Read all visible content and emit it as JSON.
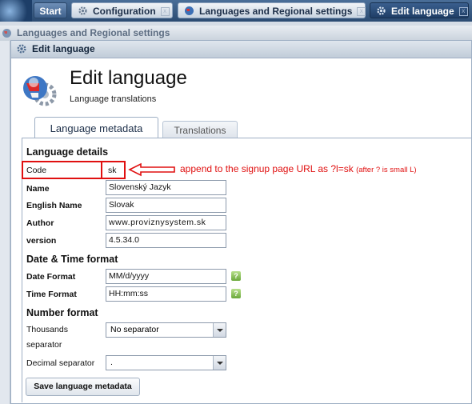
{
  "taskbar": {
    "start_label": "Start",
    "tabs": [
      {
        "label": "Configuration",
        "close": "x"
      },
      {
        "label": "Languages and Regional settings",
        "close": "x"
      },
      {
        "label": "Edit language",
        "close": "x"
      }
    ]
  },
  "window_back": {
    "title": "Languages and Regional settings"
  },
  "window": {
    "title": "Edit language"
  },
  "header": {
    "title": "Edit language",
    "subtitle": "Language translations"
  },
  "tabs": {
    "metadata": "Language metadata",
    "translations": "Translations"
  },
  "language_details": {
    "heading": "Language details",
    "code_label": "Code",
    "code_value": "sk",
    "name_label": "Name",
    "name_value": "Slovenský Jazyk",
    "english_name_label": "English Name",
    "english_name_value": "Slovak",
    "author_label": "Author",
    "author_value": "www.proviznysystem.sk",
    "version_label": "version",
    "version_value": "4.5.34.0"
  },
  "datetime": {
    "heading": "Date & Time format",
    "date_label": "Date Format",
    "date_value": "MM/d/yyyy",
    "time_label": "Time Format",
    "time_value": "HH:mm:ss",
    "help": "?"
  },
  "number": {
    "heading": "Number format",
    "thousands_label_1": "Thousands",
    "thousands_label_2": "separator",
    "thousands_value": "No separator",
    "decimal_label": "Decimal separator",
    "decimal_value": "."
  },
  "annotation": {
    "main": "append to the signup page URL as ?l=sk",
    "small": "(after ? is small L)",
    "color": "#e01010"
  },
  "save_button": "Save language metadata"
}
